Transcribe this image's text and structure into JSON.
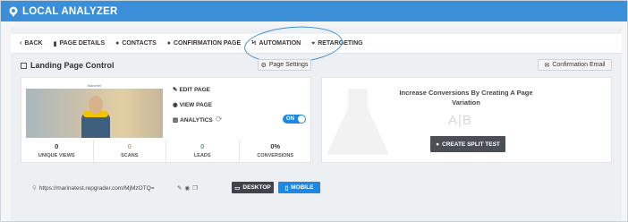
{
  "app": {
    "title": "LOCAL ANALYZER"
  },
  "nav": {
    "items": [
      {
        "label": "BACK",
        "icon": "chevron-left-icon",
        "glyph": "‹"
      },
      {
        "label": "PAGE DETAILS",
        "icon": "chart-icon",
        "glyph": "▮"
      },
      {
        "label": "CONTACTS",
        "icon": "user-icon",
        "glyph": "●"
      },
      {
        "label": "CONFIRMATION PAGE",
        "icon": "circle-icon",
        "glyph": "●"
      },
      {
        "label": "AUTOMATION",
        "icon": "bolt-icon",
        "glyph": "ϟ"
      },
      {
        "label": "RETARGETING",
        "icon": "crosshair-icon",
        "glyph": "⌖"
      }
    ]
  },
  "section": {
    "title": "Landing Page Control",
    "page_settings": "Page Settings",
    "confirmation_email": "Confirmation Email"
  },
  "preview": {
    "header_text": "Marketer"
  },
  "actions": {
    "edit_page": "EDIT PAGE",
    "view_page": "VIEW PAGE",
    "analytics": "ANALYTICS",
    "analytics_toggle": "ON"
  },
  "stats": [
    {
      "value": "0",
      "label": "UNIQUE VIEWS",
      "color": "#333333"
    },
    {
      "value": "0",
      "label": "SCANS",
      "color": "#e8a317"
    },
    {
      "value": "0",
      "label": "LEADS",
      "color": "#23b0a6"
    },
    {
      "value": "0%",
      "label": "CONVERSIONS",
      "color": "#333333"
    }
  ],
  "split": {
    "headline": "Increase Conversions By Creating A Page Variation",
    "ab_label": "A|B",
    "button": "CREATE SPLIT TEST"
  },
  "url": {
    "value": "https://marinatest.repgrader.com/MjMzOTQ=",
    "desktop": "DESKTOP",
    "mobile": "MOBILE"
  },
  "colors": {
    "brand": "#3b8fd9",
    "accent_blue": "#1e88e5",
    "highlight": "#3a8fd6"
  }
}
